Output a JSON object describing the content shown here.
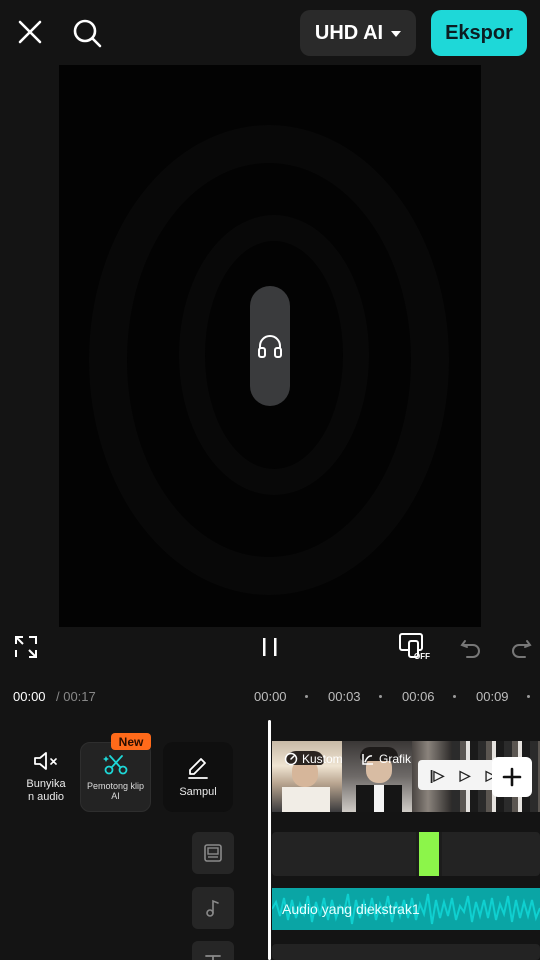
{
  "topbar": {
    "resolution_label": "UHD AI",
    "export_label": "Ekspor",
    "icons": [
      "close-icon",
      "search-icon",
      "chevron-down-icon"
    ]
  },
  "preview": {
    "overlay_icon": "headphones-icon"
  },
  "controls": {
    "icons": [
      "fullscreen-icon",
      "pause-icon",
      "device-off-icon",
      "undo-icon",
      "redo-icon"
    ],
    "off_label": "OFF"
  },
  "timeline": {
    "current_time": "00:00",
    "total_time": "/ 00:17",
    "ruler": [
      "00:00",
      "00:03",
      "00:06",
      "00:09"
    ]
  },
  "tools": {
    "mute_label": "Bunyika\nn audio",
    "ai_cut_label": "Pemotong klip AI",
    "ai_badge": "New",
    "cover_label": "Sampul"
  },
  "tracks": {
    "clip_tags": [
      "Kustom",
      "Grafik"
    ],
    "audio_label": "Audio yang diekstrak1",
    "icons": [
      "overlay-track-icon",
      "music-note-icon",
      "text-icon"
    ]
  },
  "colors": {
    "accent": "#1ed8d8",
    "badge": "#ff6a1a",
    "audio": "#0aa5a5",
    "effect": "#8cf54a"
  }
}
